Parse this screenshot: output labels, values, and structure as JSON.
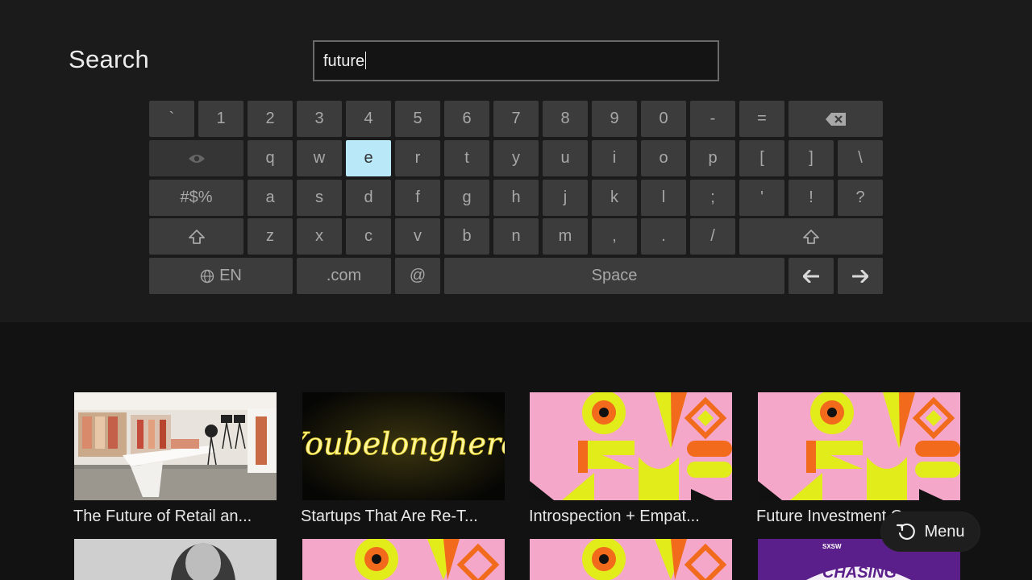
{
  "search": {
    "title": "Search",
    "query": "future"
  },
  "keyboard": {
    "rows": [
      [
        "`",
        "1",
        "2",
        "3",
        "4",
        "5",
        "6",
        "7",
        "8",
        "9",
        "0",
        "-",
        "=",
        "backspace-icon"
      ],
      [
        "eye-icon",
        "q",
        "w",
        "e",
        "r",
        "t",
        "y",
        "u",
        "i",
        "o",
        "p",
        "[",
        "]",
        "\\"
      ],
      [
        "#$%",
        "a",
        "s",
        "d",
        "f",
        "g",
        "h",
        "j",
        "k",
        "l",
        ";",
        "'",
        "!",
        "?"
      ],
      [
        "shift-icon",
        "z",
        "x",
        "c",
        "v",
        "b",
        "n",
        "m",
        ",",
        ".",
        "/",
        "shift-icon"
      ],
      [
        "EN",
        ".com",
        "@",
        "Space",
        "arrow-left-icon",
        "arrow-right-icon"
      ]
    ],
    "focused_key": "e",
    "language_label": "EN",
    "dotcom_label": ".com",
    "at_label": "@",
    "space_label": "Space",
    "symbols_label": "#$%",
    "focus_color": "#b9e8f8",
    "key_color": "#3c3c3c"
  },
  "results": [
    {
      "title": "The Future of Retail an...",
      "thumb": "retail-store-photo"
    },
    {
      "title": "Startups That Are Re-T...",
      "thumb": "neon-sign-you-belong-here"
    },
    {
      "title": "Introspection + Empat...",
      "thumb": "pink-geometric-pattern"
    },
    {
      "title": "Future Investment Op...",
      "thumb": "pink-geometric-pattern"
    }
  ],
  "results_row2": [
    {
      "thumb": "grayscale-portrait"
    },
    {
      "thumb": "pink-geometric-pattern"
    },
    {
      "thumb": "pink-geometric-pattern"
    },
    {
      "thumb": "sxsw-chasing-poster",
      "text": "CHASING",
      "badge": "SXSW"
    }
  ],
  "neon_text": "Youbelonghere",
  "menu": {
    "label": "Menu",
    "icon": "replay-icon"
  }
}
